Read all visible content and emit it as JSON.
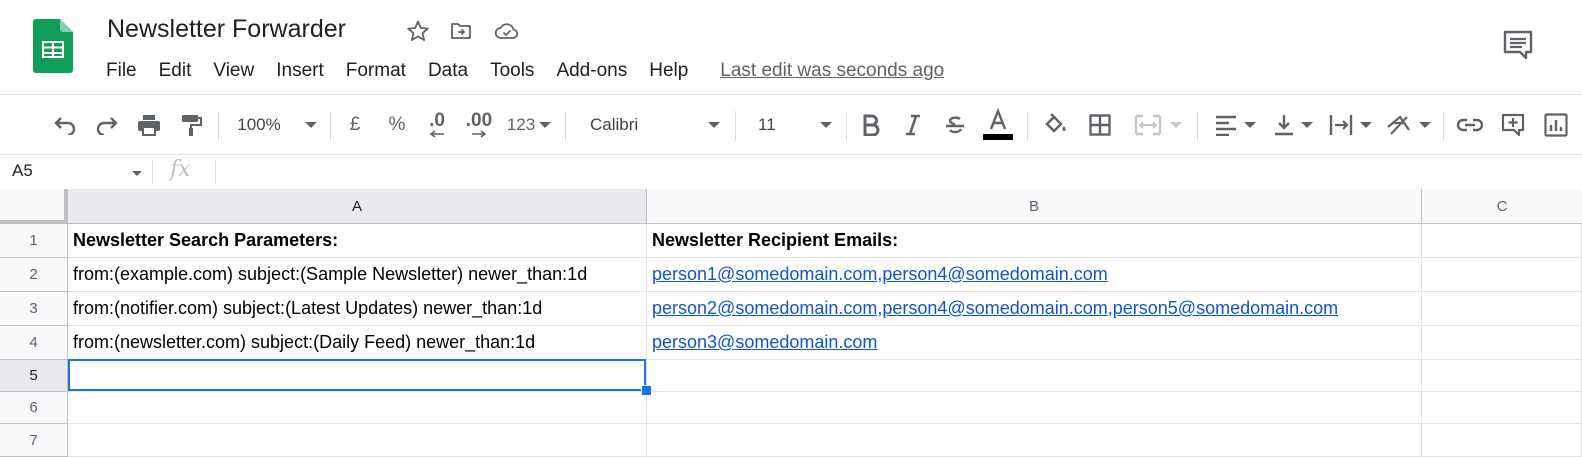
{
  "app": {
    "title": "Newsletter Forwarder",
    "last_edit": "Last edit was seconds ago",
    "brand_color": "#0f9d58"
  },
  "menu": [
    "File",
    "Edit",
    "View",
    "Insert",
    "Format",
    "Data",
    "Tools",
    "Add-ons",
    "Help"
  ],
  "toolbar": {
    "zoom": "100%",
    "currency": "£",
    "percent": "%",
    "decrease_decimal": ".0",
    "increase_decimal": ".00",
    "more_formats": "123",
    "font_family": "Calibri",
    "font_size": "11"
  },
  "formula_bar": {
    "name_box": "A5",
    "fx": "fx",
    "content": ""
  },
  "sheet": {
    "columns": [
      "A",
      "B",
      "C"
    ],
    "rows": [
      "1",
      "2",
      "3",
      "4",
      "5",
      "6",
      "7"
    ],
    "selected_cell": "A5",
    "cells": {
      "A1": "Newsletter Search Parameters:",
      "B1": "Newsletter Recipient Emails:",
      "A2": "from:(example.com) subject:(Sample Newsletter) newer_than:1d",
      "B2": "person1@somedomain.com,person4@somedomain.com",
      "A3": "from:(notifier.com) subject:(Latest Updates) newer_than:1d",
      "B3": "person2@somedomain.com,person4@somedomain.com,person5@somedomain.com",
      "A4": "from:(newsletter.com) subject:(Daily Feed) newer_than:1d",
      "B4": "person3@somedomain.com"
    }
  }
}
